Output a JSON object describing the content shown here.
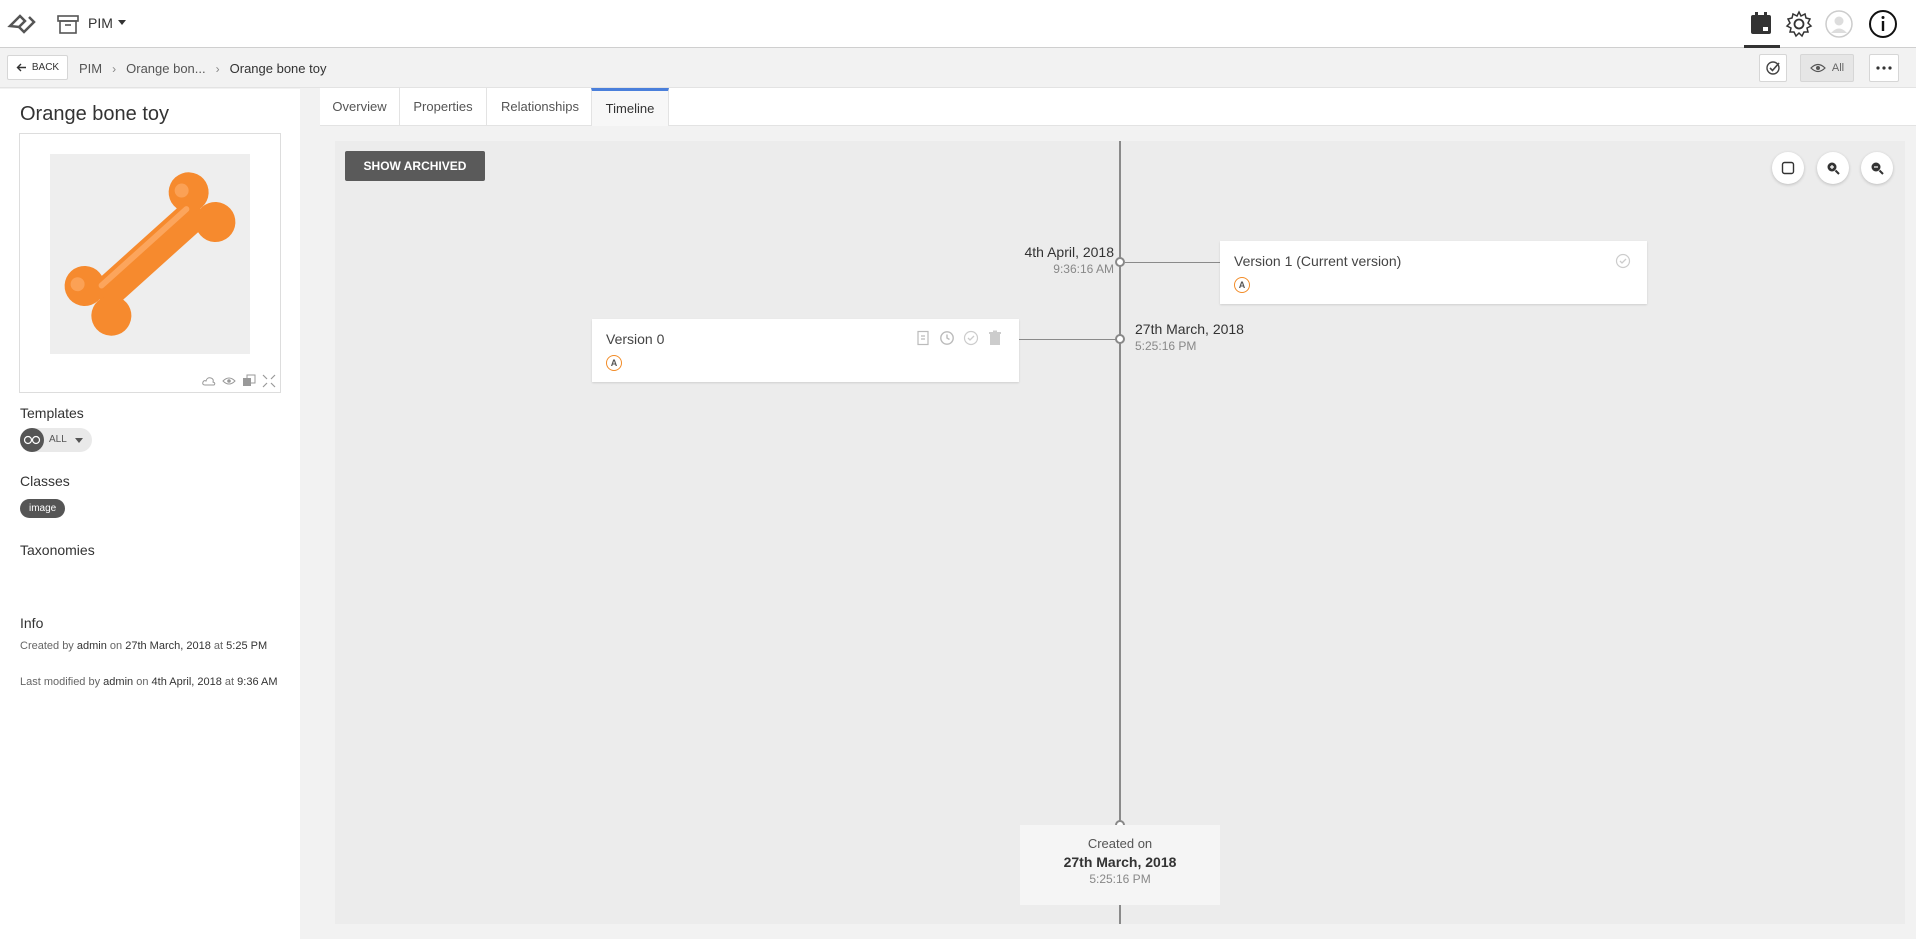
{
  "app": {
    "name": "PIM"
  },
  "breadcrumb": {
    "back_label": "BACK",
    "items": [
      "PIM",
      "Orange bon...",
      "Orange bone toy"
    ]
  },
  "view_filter": {
    "label": "All"
  },
  "asset": {
    "title": "Orange bone toy",
    "templates_label": "Templates",
    "template_value": "ALL",
    "classes_label": "Classes",
    "class_chip": "image",
    "taxonomies_label": "Taxonomies",
    "info_label": "Info",
    "created": {
      "prefix": "Created by",
      "user": "admin",
      "on": "on",
      "date": "27th March, 2018",
      "at": "at",
      "time": "5:25 PM"
    },
    "modified": {
      "prefix": "Last modified by",
      "user": "admin",
      "on": "on",
      "date": "4th April, 2018",
      "at": "at",
      "time": "9:36 AM"
    }
  },
  "tabs": [
    {
      "label": "Overview",
      "active": false
    },
    {
      "label": "Properties",
      "active": false
    },
    {
      "label": "Relationships",
      "active": false
    },
    {
      "label": "Timeline",
      "active": true
    }
  ],
  "timeline": {
    "show_archived_label": "SHOW ARCHIVED",
    "versions": [
      {
        "title": "Version 1 (Current version)",
        "user_initial": "A",
        "date": "4th April, 2018",
        "time": "9:36:16 AM"
      },
      {
        "title": "Version 0",
        "user_initial": "A",
        "date": "27th March, 2018",
        "time": "5:25:16 PM"
      }
    ],
    "created": {
      "label": "Created on",
      "date": "27th March, 2018",
      "time": "5:25:16 PM"
    }
  },
  "colors": {
    "accent": "#4a7fdb",
    "user_badge": "#f28c28",
    "bone": "#f68a2e"
  }
}
